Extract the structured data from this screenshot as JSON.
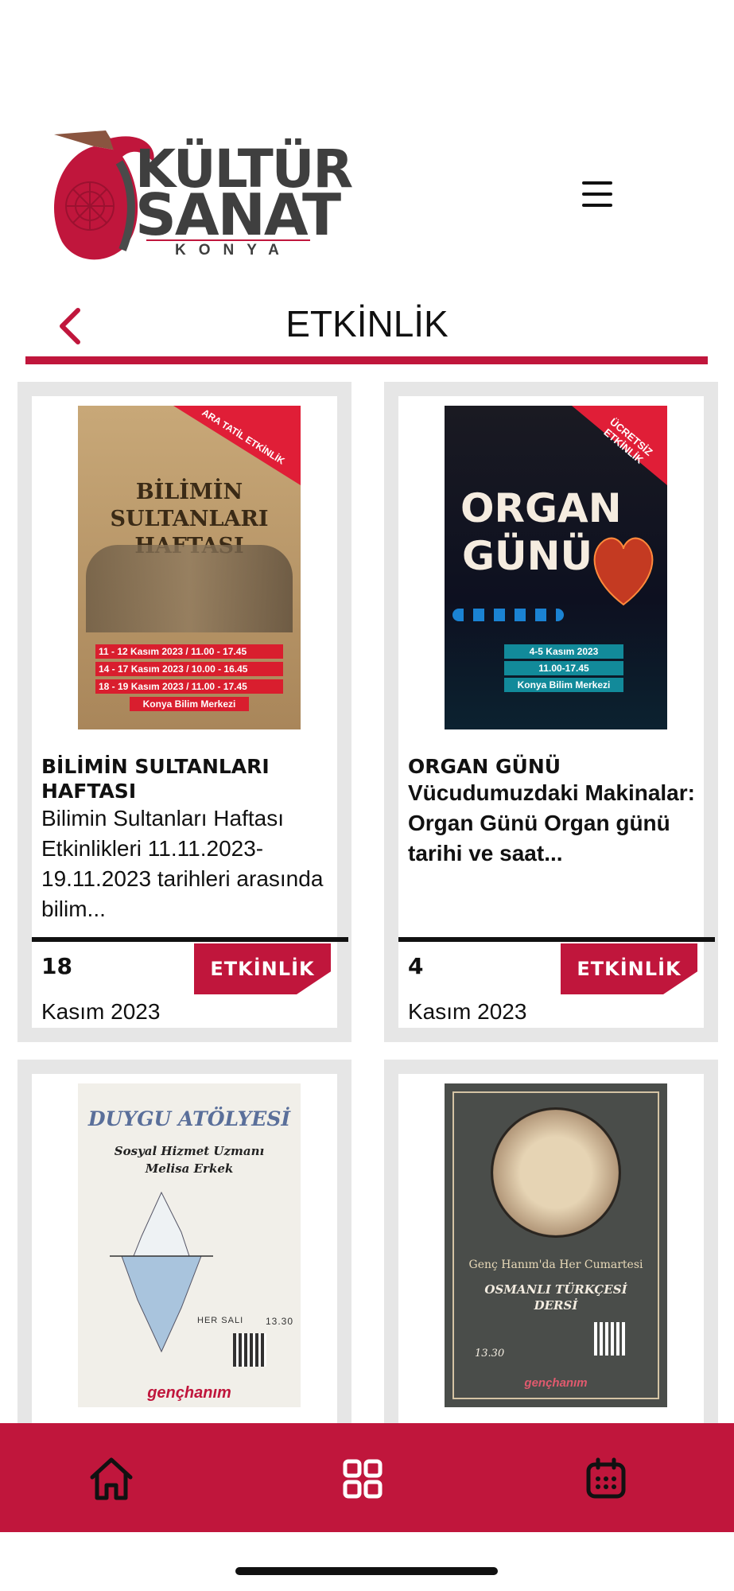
{
  "header": {
    "logo_line1": "KÜLTÜR",
    "logo_line2": "SANAT",
    "logo_line3": "KONYA",
    "menu_icon": "hamburger-icon"
  },
  "page": {
    "title": "ETKİNLİK",
    "back_icon": "chevron-left-icon"
  },
  "colors": {
    "accent": "#c0163c",
    "card_bg": "#e6e6e6"
  },
  "events": [
    {
      "title": "BİLİMİN SULTANLARI HAFTASI",
      "description": "Bilimin Sultanları Haftası Etkinlikleri 11.11.2023-19.11.2023 tarihleri arasında bilim...",
      "day": "18",
      "month": "Kasım 2023",
      "tag": "ETKİNLİK",
      "poster": {
        "corner": "ARA TATİL ETKİNLİK",
        "headline": "BİLİMİN SULTANLARI HAFTASI",
        "dates": [
          "11 - 12 Kasım 2023 / 11.00 - 17.45",
          "14 - 17 Kasım 2023 / 10.00 - 16.45",
          "18 - 19 Kasım 2023 / 11.00 - 17.45"
        ],
        "venue": "Konya Bilim Merkezi"
      }
    },
    {
      "title": "ORGAN GÜNÜ",
      "description": "Vücudumuzdaki Makinalar: Organ Günü Organ günü tarihi ve saat...",
      "day": "4",
      "month": "Kasım 2023",
      "tag": "ETKİNLİK",
      "poster": {
        "corner": "ÜCRETSİZ ETKİNLİK",
        "headline1": "ORGAN",
        "headline2": "GÜNÜ",
        "date": "4-5 Kasım 2023",
        "time": "11.00-17.45",
        "venue": "Konya Bilim Merkezi"
      }
    },
    {
      "poster": {
        "headline": "DUYGU ATÖLYESİ",
        "sub1": "Sosyal Hizmet Uzmanı",
        "sub2": "Melisa Erkek",
        "day": "HER SALI",
        "time": "13.30",
        "brand": "gençhanım"
      }
    },
    {
      "poster": {
        "line1": "Genç Hanım'da Her Cumartesi",
        "line2": "OSMANLI TÜRKÇESİ",
        "line3": "DERSİ",
        "time": "13.30",
        "brand": "gençhanım"
      }
    }
  ],
  "bottom_nav": [
    {
      "icon": "home-icon"
    },
    {
      "icon": "grid-icon"
    },
    {
      "icon": "calendar-icon"
    }
  ]
}
